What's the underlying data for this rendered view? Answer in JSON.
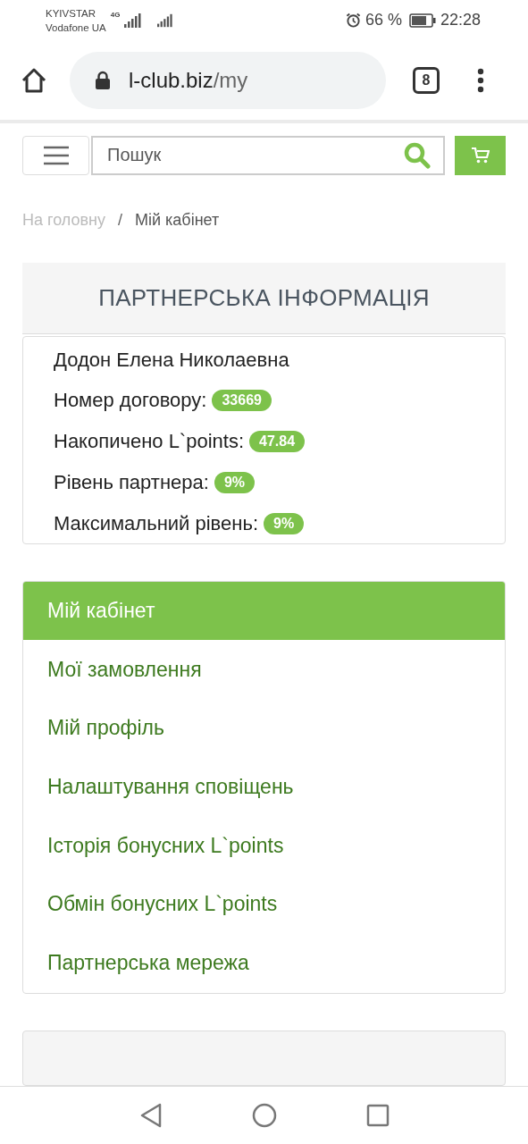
{
  "status_bar": {
    "carrier_1": "KYIVSTAR",
    "carrier_2": "Vodafone UA",
    "network": "4G",
    "battery": "66 %",
    "time": "22:28"
  },
  "browser": {
    "url_host": "l-club.biz",
    "url_path": "/my",
    "tab_count": "8"
  },
  "search": {
    "placeholder": "Пошук"
  },
  "breadcrumb": [
    "На головну",
    "/",
    "Мій кабінет"
  ],
  "partner_panel": {
    "title": "ПАРТНЕРСЬКА ІНФОРМАЦІЯ",
    "name": "Додон Елена Николаевна",
    "rows": [
      {
        "label": "Номер договору:",
        "badge": "33669"
      },
      {
        "label": "Накопичено L`points:",
        "badge": "47.84"
      },
      {
        "label": "Рівень партнера:",
        "badge": "9%"
      },
      {
        "label": "Максимальний рівень:",
        "badge": "9%"
      }
    ]
  },
  "menu": [
    {
      "label": "Мій кабінет",
      "selected": true
    },
    {
      "label": "Мої замовлення",
      "selected": false
    },
    {
      "label": "Мій профіль",
      "selected": false
    },
    {
      "label": "Налаштування сповіщень",
      "selected": false
    },
    {
      "label": "Історія бонусних L`points",
      "selected": false
    },
    {
      "label": "Обмін бонусних L`points",
      "selected": false
    },
    {
      "label": "Партнерська мережа",
      "selected": false
    }
  ]
}
